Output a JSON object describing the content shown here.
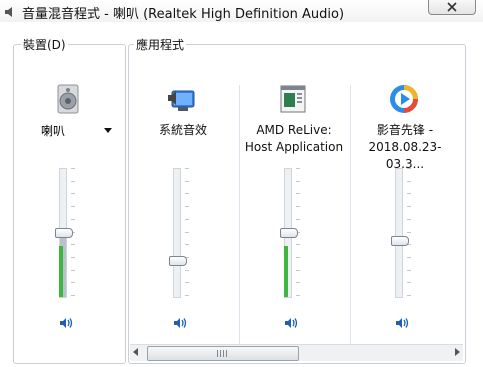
{
  "window": {
    "title": "音量混音程式 - 喇叭 (Realtek High Definition Audio)"
  },
  "device_group": {
    "label": "裝置(D)",
    "device": {
      "name": "喇叭",
      "icon": "speaker-device-icon",
      "volume_fraction": 0.5,
      "peak_fraction": 0.4
    }
  },
  "apps_group": {
    "label": "應用程式",
    "apps": [
      {
        "name": "系統音效",
        "icon": "system-sounds-icon",
        "volume_fraction": 0.27
      },
      {
        "name": "AMD ReLive:\nHost Application",
        "icon": "amd-relive-app-icon",
        "volume_fraction": 0.5,
        "peak_fraction": 0.4
      },
      {
        "name": "影音先锋 -\n2018.08.23-03.3...",
        "icon": "media-player-app-icon",
        "volume_fraction": 0.43
      }
    ]
  },
  "colors": {
    "peak_meter": "#3fb63f",
    "mute_icon": "#1f5fb8"
  },
  "horizontal_scroll": {
    "thumb_fraction": 0.0
  }
}
